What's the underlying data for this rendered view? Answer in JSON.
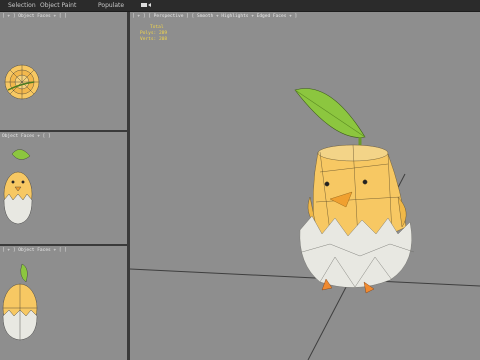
{
  "menu": {
    "items": [
      "Selection",
      "Object Paint",
      "Populate"
    ],
    "extra_icon": "view-options-icon"
  },
  "viewports": {
    "top": {
      "label": "[ + ] Object Faces + [ ]"
    },
    "front": {
      "label": "Object Faces + [ ]"
    },
    "left": {
      "label": "[ + ] Object Faces + [ ]"
    },
    "perspective": {
      "label": "[ + ] [ Perspective ] [ Smooth + Highlights + Edged Faces + ]",
      "stats": {
        "title": "Total",
        "polys": "Polys: 289",
        "verts": "Verts: 208"
      }
    }
  },
  "colors": {
    "viewport_bg": "#8e8e8e",
    "ui_dark": "#2b2b2b",
    "chick_yellow": "#f7c863",
    "shell_white": "#e8e8e2",
    "leaf_green": "#8cc63f",
    "stats_yellow": "#f2d64a"
  }
}
